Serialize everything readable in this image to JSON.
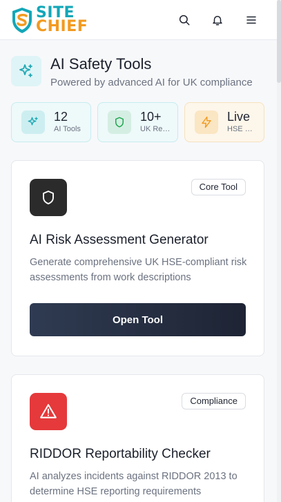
{
  "header": {
    "logo_top": "SITE",
    "logo_bottom": "CHIEF",
    "icons": [
      "search-icon",
      "bell-icon",
      "menu-icon"
    ]
  },
  "page": {
    "title": "AI Safety Tools",
    "subtitle": "Powered by advanced AI for UK compliance",
    "icon": "sparkles-icon"
  },
  "stats": [
    {
      "value": "12",
      "label": "AI Tools",
      "icon": "sparkles-icon",
      "color": "#20a9b5"
    },
    {
      "value": "10+",
      "label": "UK Regulations",
      "icon": "shield-icon",
      "color": "#16a34a"
    },
    {
      "value": "Live",
      "label": "HSE Updates",
      "icon": "bolt-icon",
      "color": "#f29a1f"
    }
  ],
  "tools": [
    {
      "title": "AI Risk Assessment Generator",
      "badge": "Core Tool",
      "description": "Generate comprehensive UK HSE-compliant risk assessments from work descriptions",
      "button": "Open Tool",
      "icon": "shield-icon",
      "icon_bg": "#2b2b2b"
    },
    {
      "title": "RIDDOR Reportability Checker",
      "badge": "Compliance",
      "description": "AI analyzes incidents against RIDDOR 2013 to determine HSE reporting requirements",
      "icon": "warning-triangle-icon",
      "icon_bg": "#e5393b"
    }
  ],
  "colors": {
    "brand_teal": "#13a7b8",
    "brand_orange": "#f29a1f",
    "button_dark": "#1e2434"
  }
}
